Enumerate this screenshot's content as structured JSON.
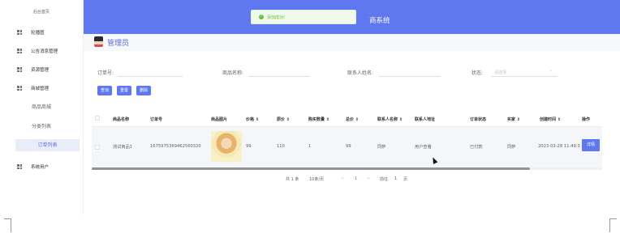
{
  "sidebar": {
    "home": "后台首页",
    "items": [
      {
        "label": "轮播图"
      },
      {
        "label": "公告消息管理"
      },
      {
        "label": "资源管理"
      },
      {
        "label": "商城管理"
      }
    ],
    "subitems": [
      {
        "label": "商品商城"
      },
      {
        "label": "分类列表"
      },
      {
        "label": "订单列表"
      }
    ],
    "bottom_item": {
      "label": "系统用户"
    }
  },
  "header": {
    "title_visible": "商系统",
    "accent_color": "#5f78f0"
  },
  "toast": {
    "message": "添加成功!",
    "status_color": "#67c23a"
  },
  "user": {
    "name": "管理员"
  },
  "filters": {
    "order_no_label": "订单号:",
    "product_name_label": "商品名称:",
    "contact_label": "联系人姓名:",
    "status_label": "状态:",
    "status_placeholder": "请选择"
  },
  "actions": {
    "search": "查询",
    "reset": "重置",
    "delete": "删除"
  },
  "table": {
    "headers": [
      "商品名称",
      "订单号",
      "商品图片",
      "价格 ⇕",
      "原价 ⇕",
      "购买数量 ⇕",
      "总价 ⇕",
      "联系人名称 ⇕",
      "联系人地址",
      "订单状态",
      "买家 ⇕",
      "创建时间 ⇕",
      "操作"
    ],
    "rows": [
      {
        "name": "测试商品1",
        "order_no": "1675975369462560320",
        "price": "99",
        "original_price": "110",
        "quantity": "1",
        "total": "99",
        "contact": "同萨",
        "address": "用户查看",
        "status": "已付款",
        "buyer": "同萨",
        "created": "2023-03-28 11:49:3",
        "action": "详情"
      }
    ]
  },
  "pagination": {
    "total": "共 1 条",
    "page_size": "10条/页",
    "prev": "<",
    "current": "1",
    "next": ">",
    "goto_label": "前往",
    "goto_value": "1",
    "page_unit": "页"
  }
}
